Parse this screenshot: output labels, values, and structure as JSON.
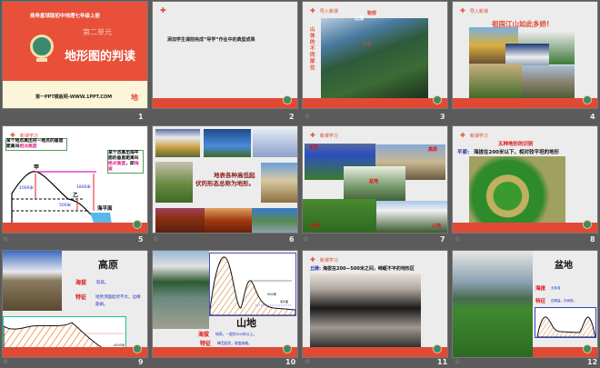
{
  "slides": [
    {
      "number": "1",
      "publisher": "商务星球版初中地理七年级上册",
      "unit": "第二单元",
      "title": "地形图的判读",
      "footer": "第一PPT模板网-WWW.1PPT.COM",
      "corner": "地"
    },
    {
      "number": "2",
      "text": "添加学生课前完成“导学”作业中的典型成果"
    },
    {
      "number": "3",
      "header": "导入新课",
      "side": "山体的不同部位",
      "labels": [
        "鞍部",
        "山顶",
        "山谷"
      ]
    },
    {
      "number": "4",
      "header": "导入新课",
      "title": "祖国江山如此多娇!"
    },
    {
      "number": "5",
      "header": "新课学习",
      "left_box": [
        "某个地点高出另一地点的垂直距离叫",
        "相对高度"
      ],
      "right_box": [
        "某个点高出海平面的垂直距离叫",
        "绝对高度",
        "，即",
        "海拔"
      ],
      "jia": "甲",
      "yi": "乙",
      "h1": "1000米",
      "h2": "1800米",
      "h3": "500米",
      "sea": "海平面"
    },
    {
      "number": "6",
      "text": "地表各种高低起伏的形态总称为地形。"
    },
    {
      "number": "7",
      "header": "新课学习",
      "labels": [
        "平原",
        "高原",
        "盆地",
        "丘陵",
        "山地"
      ]
    },
    {
      "number": "8",
      "header": "新课学习",
      "title": "五种地形的识别",
      "term": "平原:",
      "desc": "海拔在200米以下，相对较平坦的地形"
    },
    {
      "number": "9",
      "title": "高原",
      "k1": "海拔",
      "v1": "较高。",
      "k2": "特征",
      "v2": "地势顶面起伏不大，边缘陡峭。",
      "mark": "4000米"
    },
    {
      "number": "10",
      "title": "山地",
      "k1": "海拔",
      "v1": "较高，一般在500米以上。",
      "k2": "特征",
      "v2": "峰峦起伏，坡度陡峻。",
      "mark": "500米",
      "sea": "海平面"
    },
    {
      "number": "11",
      "header": "新课学习",
      "term": "丘陵:",
      "desc": "海拔在200—500米之间，崎岖不平的地形区"
    },
    {
      "number": "12",
      "title": "盆地",
      "k1": "海拔",
      "v1": "无标准",
      "k2": "特征",
      "v2": "四周高，中间低。"
    }
  ],
  "colors": {
    "accent": "#e04a35",
    "background": "#5b5b5b",
    "slide": "#ececec"
  }
}
